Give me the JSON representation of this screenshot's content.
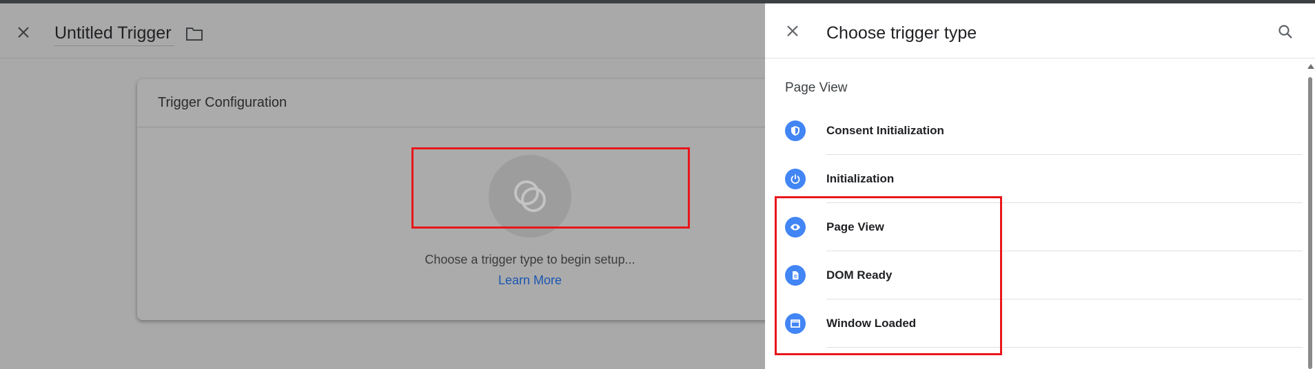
{
  "editor": {
    "title": "Untitled Trigger",
    "card_title": "Trigger Configuration",
    "prompt": "Choose a trigger type to begin setup...",
    "learn_more": "Learn More"
  },
  "panel": {
    "title": "Choose trigger type",
    "section": "Page View",
    "items": [
      {
        "label": "Consent Initialization",
        "icon": "shield-icon"
      },
      {
        "label": "Initialization",
        "icon": "power-icon"
      },
      {
        "label": "Page View",
        "icon": "eye-icon"
      },
      {
        "label": "DOM Ready",
        "icon": "document-icon"
      },
      {
        "label": "Window Loaded",
        "icon": "window-icon"
      }
    ]
  },
  "colors": {
    "accent": "#4285f4",
    "link": "#1a56b0",
    "highlight": "#e8161b",
    "overlay": "#a9a9a9"
  }
}
